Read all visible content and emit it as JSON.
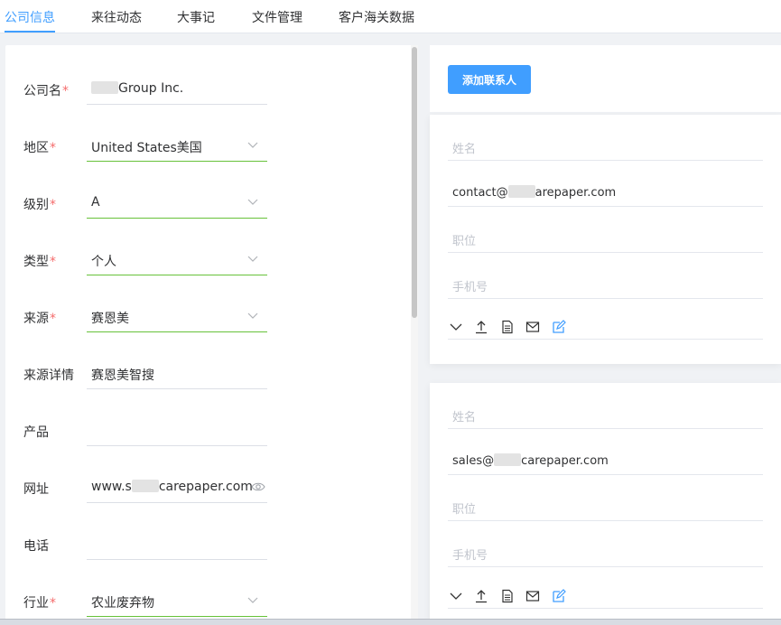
{
  "tabs": [
    {
      "label": "公司信息"
    },
    {
      "label": "来往动态"
    },
    {
      "label": "大事记"
    },
    {
      "label": "文件管理"
    },
    {
      "label": "客户海关数据"
    }
  ],
  "form": {
    "company_name": {
      "label": "公司名",
      "value": "Group Inc."
    },
    "region": {
      "label": "地区",
      "value": "United States美国"
    },
    "level": {
      "label": "级别",
      "value": "A"
    },
    "type": {
      "label": "类型",
      "value": "个人"
    },
    "source": {
      "label": "来源",
      "value": "赛恩美"
    },
    "source_detail": {
      "label": "来源详情",
      "value": "赛恩美智搜"
    },
    "product": {
      "label": "产品",
      "value": ""
    },
    "website": {
      "label": "网址",
      "prefix": "www.s",
      "suffix": "carepaper.com"
    },
    "phone": {
      "label": "电话",
      "value": ""
    },
    "industry": {
      "label": "行业",
      "value": "农业废弃物"
    }
  },
  "contacts": {
    "add_button": "添加联系人",
    "placeholders": {
      "name": "姓名",
      "position": "职位",
      "mobile": "手机号"
    },
    "items": [
      {
        "email_prefix": "contact@",
        "email_suffix": "arepaper.com"
      },
      {
        "email_prefix": "sales@",
        "email_suffix": "carepaper.com"
      }
    ]
  },
  "colors": {
    "accent": "#409eff",
    "required": "#f56c6c",
    "valid": "#67c23a"
  }
}
